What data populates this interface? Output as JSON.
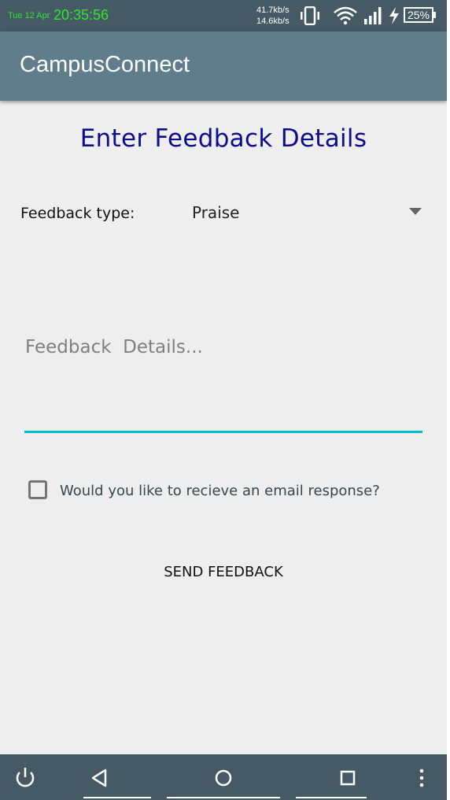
{
  "status_bar": {
    "date": "Tue 12 Apr",
    "time": "20:35:56",
    "upload_speed": "41.7kb/s",
    "download_speed": "14.6kb/s",
    "battery_percent": "25%",
    "icons": [
      "vibrate-icon",
      "wifi-icon",
      "signal-icon",
      "charging-icon",
      "battery-icon"
    ]
  },
  "app_bar": {
    "title": "CampusConnect"
  },
  "form": {
    "heading": "Enter Feedback Details",
    "type_label": "Feedback type:",
    "type_value": "Praise",
    "details_placeholder": "Feedback  Details...",
    "details_value": "",
    "email_checkbox_label": "Would you like to recieve an email response?",
    "email_checkbox_checked": false,
    "send_label": "SEND FEEDBACK"
  },
  "nav_bar": {
    "buttons": [
      "power-icon",
      "back-icon",
      "home-icon",
      "recents-icon",
      "menu-icon"
    ]
  },
  "colors": {
    "status_bar": "#455a64",
    "app_bar": "#607d8b",
    "heading": "#0d0d8c",
    "accent": "#00bcd4",
    "clock": "#32e632"
  }
}
